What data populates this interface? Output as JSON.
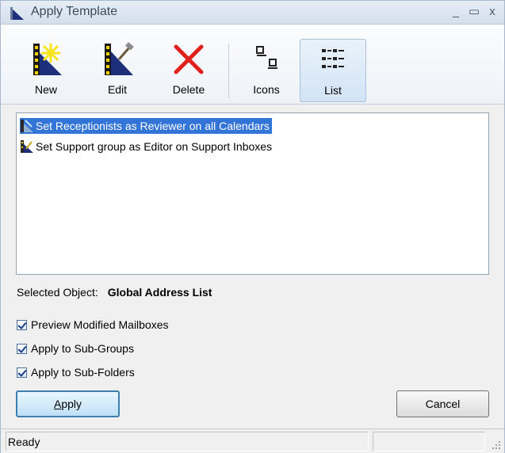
{
  "window": {
    "title": "Apply Template",
    "minimize_glyph": "_",
    "maximize_glyph": "▭",
    "close_glyph": "x"
  },
  "toolbar": {
    "new_label": "New",
    "edit_label": "Edit",
    "delete_label": "Delete",
    "icons_label": "Icons",
    "list_label": "List",
    "active_view": "List"
  },
  "templates": [
    {
      "label": "Set Receptionists as Reviewer on all Calendars",
      "icon": "template-icon",
      "selected": true
    },
    {
      "label": "Set Support group as Editor on Support Inboxes",
      "icon": "template-icon",
      "selected": false
    }
  ],
  "selected_object": {
    "label": "Selected Object:",
    "value": "Global Address List"
  },
  "options": {
    "preview_modified_mailboxes": {
      "label": "Preview Modified Mailboxes",
      "checked": true
    },
    "apply_to_sub_groups": {
      "label": "Apply to Sub-Groups",
      "checked": true
    },
    "apply_to_sub_folders": {
      "label": "Apply to Sub-Folders",
      "checked": true
    }
  },
  "buttons": {
    "apply_label": "Apply",
    "cancel_label": "Cancel"
  },
  "status": {
    "text": "Ready"
  },
  "colors": {
    "selection": "#3375d7",
    "default_button_border": "#3c7fb1",
    "delete_icon": "#e0201b"
  }
}
